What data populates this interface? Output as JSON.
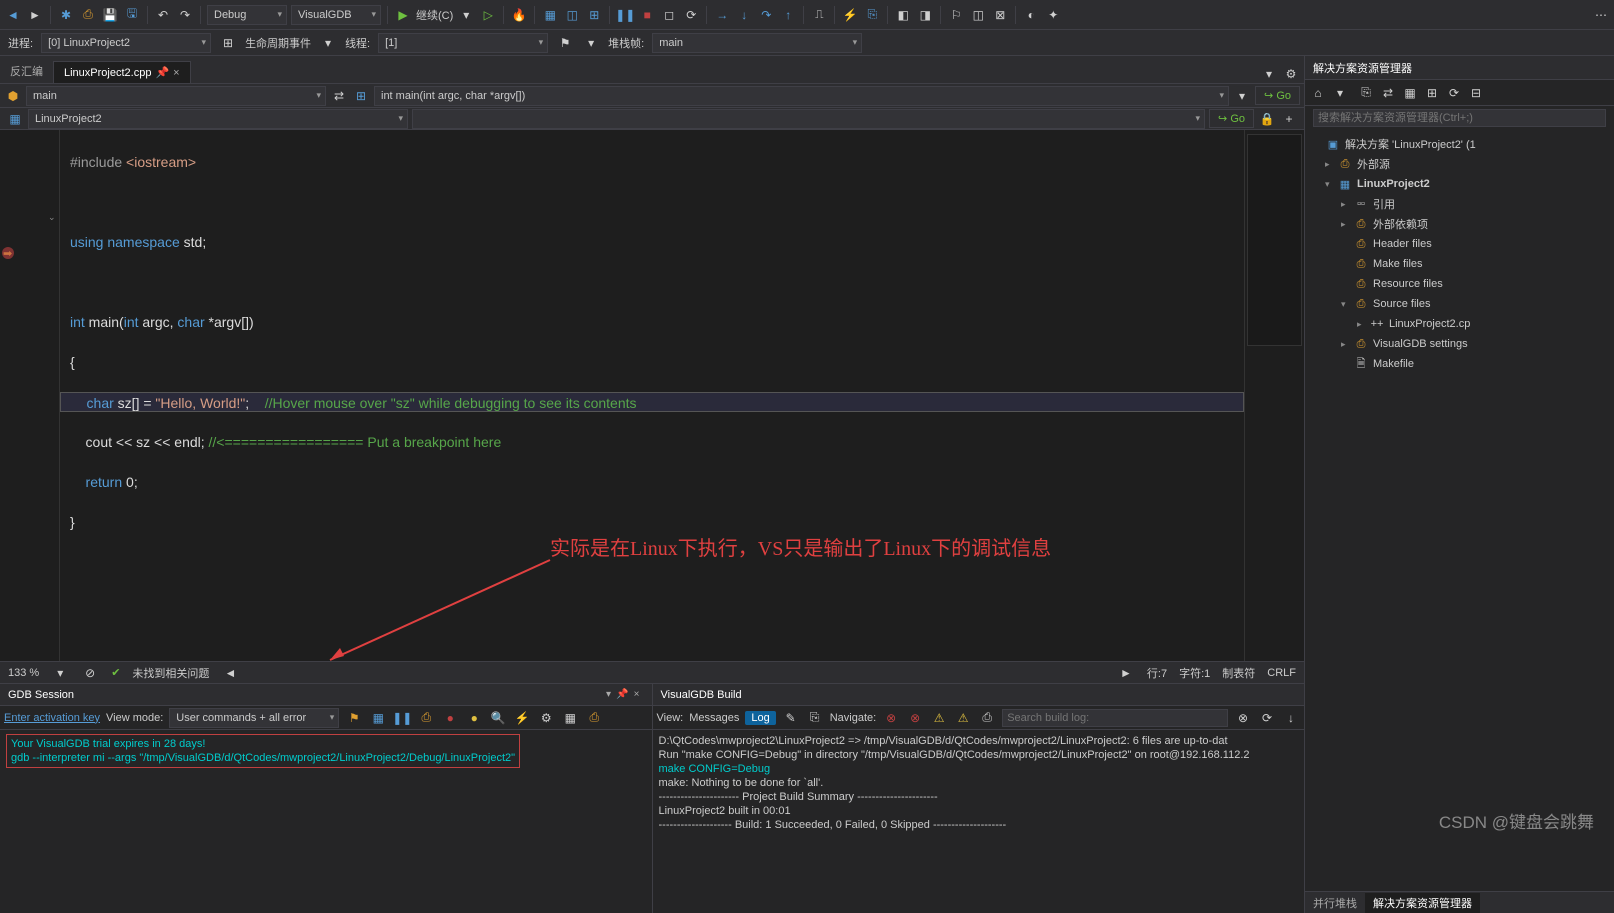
{
  "toolbar": {
    "config": "Debug",
    "platform": "VisualGDB",
    "continue_label": "继续(C)"
  },
  "row2": {
    "process_label": "进程:",
    "process_value": "[0] LinuxProject2",
    "lifecycle_label": "生命周期事件",
    "thread_label": "线程:",
    "thread_value": "[1]",
    "stackframe_label": "堆栈帧:",
    "stackframe_value": "main"
  },
  "tabs": {
    "disasm": "反汇编",
    "file": "LinuxProject2.cpp"
  },
  "navbar": {
    "scope": "main",
    "func": "int main(int argc, char *argv[])",
    "go": "Go"
  },
  "breadcrumb": {
    "project": "LinuxProject2",
    "go": "Go"
  },
  "code": {
    "l1_a": "#include ",
    "l1_b": "<iostream>",
    "l2_a": "using",
    "l2_b": " namespace",
    "l2_c": " std;",
    "l3_a": "int",
    "l3_b": " main(",
    "l3_c": "int",
    "l3_d": " argc, ",
    "l3_e": "char",
    "l3_f": " *argv[])",
    "l4": "{",
    "l5_a": "    char",
    "l5_b": " sz[] = ",
    "l5_c": "\"Hello, World!\"",
    "l5_d": ";    ",
    "l5_e": "//Hover mouse over \"sz\" while debugging to see its contents",
    "l6_a": "    cout << sz << endl; ",
    "l6_b": "//<================= Put a breakpoint here",
    "l7_a": "    return",
    "l7_b": " 0;",
    "l8": "}"
  },
  "status": {
    "zoom": "133 %",
    "issues": "未找到相关问题",
    "line": "行:7",
    "char": "字符:1",
    "tabs": "制表符",
    "eol": "CRLF"
  },
  "gdb": {
    "title": "GDB Session",
    "activation": "Enter activation key",
    "viewmode_label": "View mode:",
    "viewmode_value": "User commands + all error",
    "line1": "Your VisualGDB trial expires in 28 days!",
    "line2": "gdb --interpreter mi --args \"/tmp/VisualGDB/d/QtCodes/mwproject2/LinuxProject2/Debug/LinuxProject2\""
  },
  "build": {
    "title": "VisualGDB Build",
    "view_label": "View:",
    "messages": "Messages",
    "log": "Log",
    "navigate": "Navigate:",
    "search_placeholder": "Search build log:",
    "b1": "D:\\QtCodes\\mwproject2\\LinuxProject2 => /tmp/VisualGDB/d/QtCodes/mwproject2/LinuxProject2: 6 files are up-to-dat",
    "b2": "Run \"make  CONFIG=Debug\" in directory \"/tmp/VisualGDB/d/QtCodes/mwproject2/LinuxProject2\" on root@192.168.112.2",
    "b3": "make  CONFIG=Debug",
    "b4": "make: Nothing to be done for `all'.",
    "b5": "---------------------- Project Build Summary ----------------------",
    "b6": "    LinuxProject2  built in 00:01",
    "b7": "-------------------- Build: 1 Succeeded, 0 Failed, 0 Skipped --------------------"
  },
  "solution": {
    "title": "解决方案资源管理器",
    "search_placeholder": "搜索解决方案资源管理器(Ctrl+;)",
    "root": "解决方案 'LinuxProject2' (1",
    "ext_src": "外部源",
    "project": "LinuxProject2",
    "references": "引用",
    "ext_deps": "外部依赖项",
    "headers": "Header files",
    "make": "Make files",
    "resource": "Resource files",
    "source": "Source files",
    "src_file": "LinuxProject2.cp",
    "vgdb": "VisualGDB settings",
    "makefile": "Makefile",
    "tab1": "并行堆栈",
    "tab2": "解决方案资源管理器"
  },
  "annotation": "实际是在Linux下执行，VS只是输出了Linux下的调试信息",
  "watermark": "CSDN @键盘会跳舞"
}
